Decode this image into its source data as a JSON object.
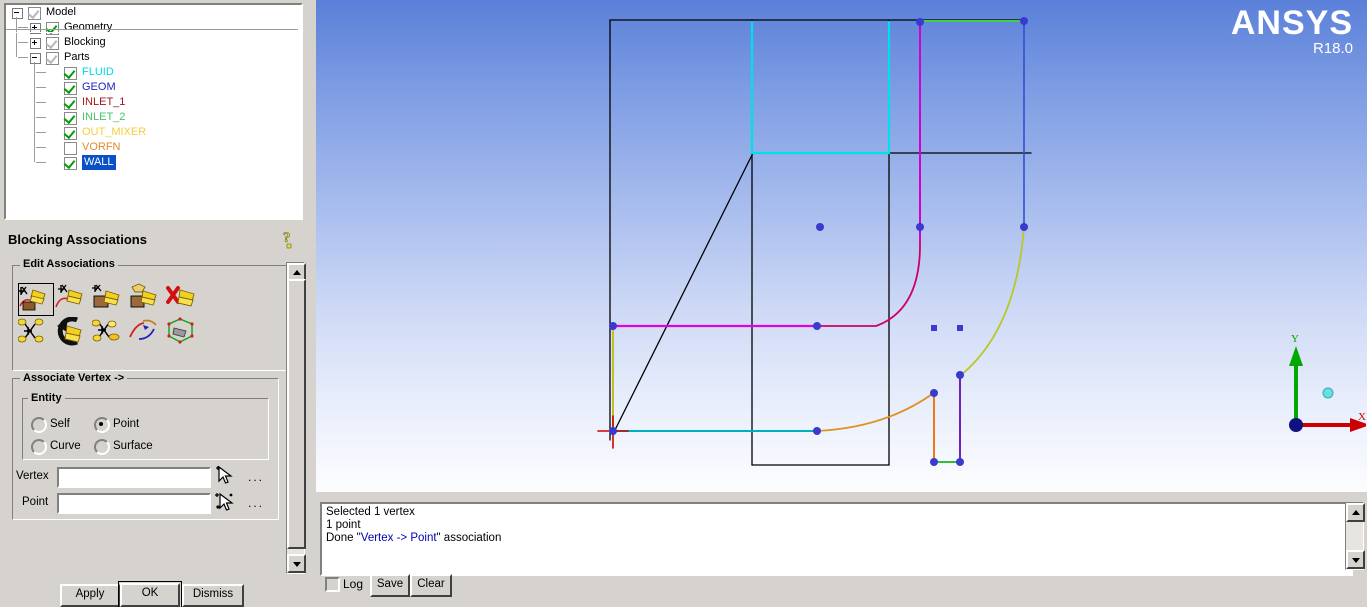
{
  "tree": {
    "nodes": [
      {
        "label": "Model",
        "depth": 0,
        "expander": "minus",
        "check": "grey",
        "color": "#000000"
      },
      {
        "label": "Geometry",
        "depth": 1,
        "expander": "plus",
        "check": "green",
        "color": "#000000"
      },
      {
        "label": "Blocking",
        "depth": 1,
        "expander": "plus",
        "check": "grey",
        "color": "#000000"
      },
      {
        "label": "Parts",
        "depth": 1,
        "expander": "minus",
        "check": "grey",
        "color": "#000000"
      },
      {
        "label": "FLUID",
        "depth": 2,
        "expander": "none",
        "check": "green",
        "color": "#00d8e0"
      },
      {
        "label": "GEOM",
        "depth": 2,
        "expander": "none",
        "check": "green",
        "color": "#2020c0"
      },
      {
        "label": "INLET_1",
        "depth": 2,
        "expander": "none",
        "check": "green",
        "color": "#a01818"
      },
      {
        "label": "INLET_2",
        "depth": 2,
        "expander": "none",
        "check": "green",
        "color": "#46c46a"
      },
      {
        "label": "OUT_MIXER",
        "depth": 2,
        "expander": "none",
        "check": "green",
        "color": "#f2cf3a"
      },
      {
        "label": "VORFN",
        "depth": 2,
        "expander": "none",
        "check": "empty",
        "color": "#e08a2a"
      },
      {
        "label": "WALL",
        "depth": 2,
        "expander": "none",
        "check": "green",
        "color": "#ffffff",
        "selected": true
      }
    ]
  },
  "associations": {
    "title": "Blocking Associations",
    "help_icon": "help-question-icon",
    "edit_group_label": "Edit Associations",
    "icons": [
      {
        "name": "associate-vertex-icon",
        "selected": true
      },
      {
        "name": "associate-edge-curve-icon",
        "selected": false
      },
      {
        "name": "associate-face-surface-icon",
        "selected": false
      },
      {
        "name": "associate-surface-group-icon",
        "selected": false
      },
      {
        "name": "disassociate-icon",
        "selected": false
      },
      {
        "name": "group-ungroup-curve-icon",
        "selected": false
      },
      {
        "name": "move-node-icon",
        "selected": false
      },
      {
        "name": "snap-project-vertices-icon",
        "selected": false
      },
      {
        "name": "reset-association-icon",
        "selected": false
      },
      {
        "name": "update-associations-icon",
        "selected": false
      }
    ],
    "associate_group_label": "Associate Vertex ->",
    "entity_group_label": "Entity",
    "entity_options": [
      {
        "label": "Self",
        "selected": false
      },
      {
        "label": "Point",
        "selected": true
      },
      {
        "label": "Curve",
        "selected": false
      },
      {
        "label": "Surface",
        "selected": false
      }
    ],
    "fields": [
      {
        "label": "Vertex",
        "value": "",
        "placeholder": "",
        "picker_icon": "select-vertex-cursor-icon",
        "more": "..."
      },
      {
        "label": "Point",
        "value": "",
        "placeholder": "",
        "picker_icon": "select-point-cursor-icon",
        "more": "..."
      }
    ]
  },
  "buttons": {
    "apply": "Apply",
    "ok": "OK",
    "dismiss": "Dismiss"
  },
  "viewport": {
    "logo_name": "ANSYS",
    "logo_release": "R18.0",
    "triad": {
      "x_label": "X",
      "y_label": "Y",
      "x_color": "#cc0000",
      "y_color": "#00a800",
      "origin_color": "#101080",
      "z_dot_color": "#66e0e0"
    },
    "colors": {
      "bg_top": "#5b80d9",
      "bg_bottom": "#fdfdff",
      "vertex": "#3a3ad0",
      "black_edge": "#000000",
      "cyan_edge": "#00e0e8",
      "magenta_edge": "#e000e0",
      "red_curve": "#d00030",
      "olive_curve": "#b8c828",
      "orange_curve": "#e09020",
      "blue_edge": "#3050d0",
      "green_edge": "#30c030",
      "purple_edge": "#7020c0",
      "orange_edge": "#f07818",
      "yellow_edge": "#c0c020",
      "teal_edge": "#00b0c0"
    }
  },
  "log": {
    "lines": [
      {
        "text": "Selected 1 vertex",
        "color": "#000000"
      },
      {
        "text": "1 point",
        "color": "#000000"
      }
    ],
    "last_line_prefix": "Done \"",
    "last_line_link": "Vertex -> Point",
    "last_line_suffix": "\" association",
    "log_checkbox_label": "Log",
    "save_button": "Save",
    "clear_button": "Clear",
    "log_checked": false
  }
}
